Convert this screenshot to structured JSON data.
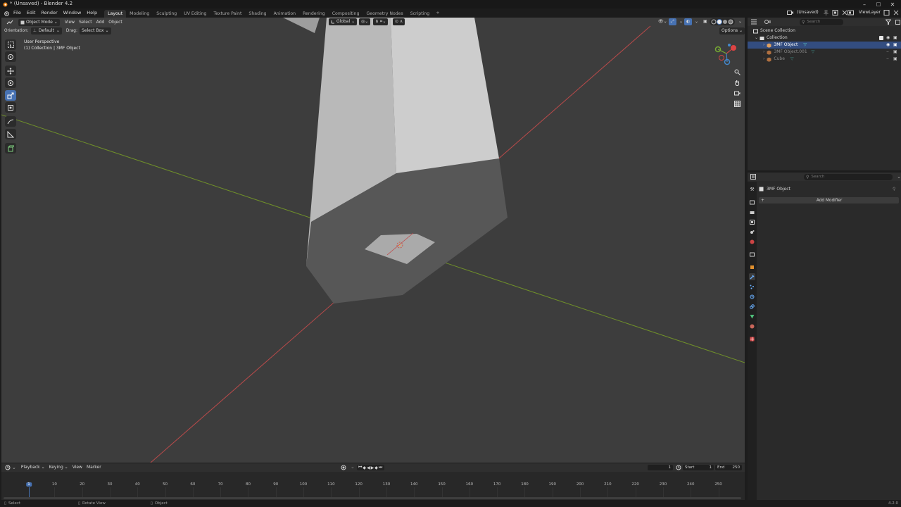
{
  "window": {
    "title": "* (Unsaved) - Blender 4.2",
    "minimize": "–",
    "maximize": "□",
    "close": "✕"
  },
  "menu": [
    "File",
    "Edit",
    "Render",
    "Window",
    "Help"
  ],
  "workspaces": [
    "Layout",
    "Modeling",
    "Sculpting",
    "UV Editing",
    "Texture Paint",
    "Shading",
    "Animation",
    "Rendering",
    "Compositing",
    "Geometry Nodes",
    "Scripting"
  ],
  "workspace_add": "+",
  "scene": {
    "name": "(Unsaved)",
    "view_layer": "ViewLayer"
  },
  "viewport": {
    "mode": "Object Mode",
    "menus": [
      "View",
      "Select",
      "Add",
      "Object"
    ],
    "transform_orientation": "Global",
    "orientation_label": "Orientation:",
    "orientation_value": "Default",
    "drag_label": "Drag:",
    "drag_value": "Select Box",
    "options": "Options",
    "info_line1": "User Perspective",
    "info_line2": "(1) Collection | 3MF Object"
  },
  "outliner": {
    "search_placeholder": "Search",
    "root": "Scene Collection",
    "collection": "Collection",
    "items": [
      {
        "name": "3MF Object",
        "selected": true
      },
      {
        "name": "3MF Object.001",
        "selected": false
      },
      {
        "name": "Cube",
        "selected": false
      }
    ]
  },
  "properties": {
    "search_placeholder": "Search",
    "object_name": "3MF Object",
    "add_modifier": "Add Modifier"
  },
  "timeline": {
    "menus": [
      "Playback",
      "Keying",
      "View",
      "Marker"
    ],
    "current_frame": "1",
    "start_label": "Start",
    "start": "1",
    "end_label": "End",
    "end": "250",
    "ticks": [
      "1",
      "10",
      "20",
      "30",
      "40",
      "50",
      "60",
      "70",
      "80",
      "90",
      "100",
      "110",
      "120",
      "130",
      "140",
      "150",
      "160",
      "170",
      "180",
      "190",
      "200",
      "210",
      "220",
      "230",
      "240",
      "250"
    ]
  },
  "statusbar": {
    "select": "Select",
    "rotate": "Rotate View",
    "object": "Object",
    "version": "4.2.0"
  },
  "colors": {
    "accent": "#4772b3",
    "x_axis": "#b84a4a",
    "y_axis": "#6f8f2a",
    "viewport_bg": "#3d3d3d",
    "playhead": "#4772b3"
  }
}
